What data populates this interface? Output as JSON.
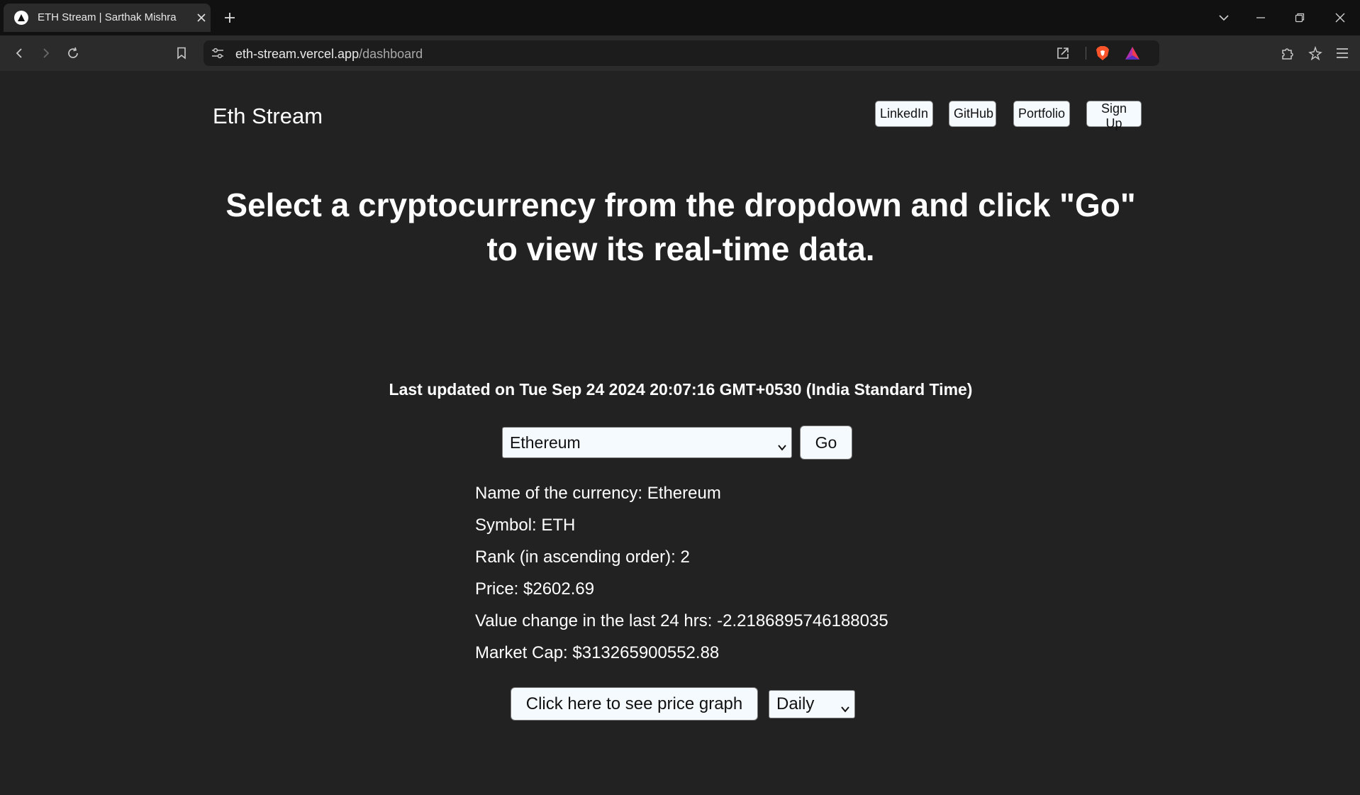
{
  "browser": {
    "tab_title": "ETH Stream | Sarthak Mishra",
    "url_host": "eth-stream.vercel.app",
    "url_path": "/dashboard"
  },
  "navbar": {
    "brand": "Eth Stream",
    "links": [
      {
        "label": "LinkedIn"
      },
      {
        "label": "GitHub"
      },
      {
        "label": "Portfolio"
      },
      {
        "label": "Sign Up"
      }
    ]
  },
  "main": {
    "headline": "Select a cryptocurrency from the dropdown and click \"Go\" to view its real-time data.",
    "last_updated": "Last updated on Tue Sep 24 2024 20:07:16 GMT+0530 (India Standard Time)",
    "currency_select": {
      "selected": "Ethereum"
    },
    "go_label": "Go",
    "info": [
      "Name of the currency: Ethereum",
      "Symbol: ETH",
      "Rank (in ascending order): 2",
      "Price: $2602.69",
      "Value change in the last 24 hrs: -2.2186895746188035",
      "Market Cap: $313265900552.88"
    ],
    "graph_button": "Click here to see price graph",
    "interval_select": {
      "selected": "Daily"
    }
  },
  "colors": {
    "page_background": "#222222",
    "tabstrip_background": "#111111",
    "toolbar_background": "#2b2b2b",
    "button_background": "#f5faff",
    "brave_orange": "#fb542b"
  },
  "icons": {
    "tab_favicon": "triangle-logo-icon",
    "tab_close": "close-icon",
    "new_tab": "plus-icon",
    "back": "arrow-left-icon",
    "forward": "arrow-right-icon",
    "reload": "reload-icon",
    "bookmark": "bookmark-icon",
    "site_info": "tune-icon",
    "share": "share-icon",
    "brave_shields": "brave-lion-icon",
    "brave_rewards": "rewards-triangle-icon",
    "extensions": "puzzle-icon",
    "leo": "sparkle-star-icon",
    "menu": "hamburger-menu-icon"
  }
}
